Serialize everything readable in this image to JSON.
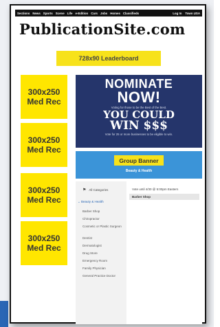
{
  "nav": {
    "links": [
      "Sections",
      "News",
      "Sports",
      "Scene",
      "Life",
      "e-Edition",
      "Cars",
      "Jobs",
      "Homes",
      "Classifieds"
    ],
    "right": [
      "Log In",
      "Town USA"
    ]
  },
  "site_title": "PublicationSite.com",
  "leaderboard_label": "728x90 Leaderboard",
  "med_recs": [
    {
      "line1": "300x250",
      "line2": "Med Rec"
    },
    {
      "line1": "300x250",
      "line2": "Med Rec"
    },
    {
      "line1": "300x250",
      "line2": "Med Rec"
    },
    {
      "line1": "300x250",
      "line2": "Med Rec"
    }
  ],
  "nominate_ad": {
    "line1": "NOMINATE",
    "line2": "NOW!",
    "subtext": "Voting for those to be the Best of the Best.",
    "line3": "YOU COULD",
    "line4": "WIN $$$",
    "footer": "Vote for 25 or more businesses to be eligible to win."
  },
  "group_banner": {
    "label": "Group Banner",
    "category": "Beauty & Health"
  },
  "directory": {
    "all_categories": "All Categories",
    "vote_until": "Vote until 4/30 @ 5:00pm Eastern",
    "selected_header": "Barber Shop",
    "active_category": "Beauty & Health",
    "items": [
      "Barber Shop",
      "Chiropractor",
      "Cosmetic or Plastic Surgeon",
      "Dentist",
      "Dermatologist",
      "Drug Store",
      "Emergency Room",
      "Family Physician",
      "General Practice Doctor"
    ]
  },
  "colors": {
    "accent_yellow": "#ffe600",
    "banner_blue": "#3b94d8",
    "ad_navy": "#25356b"
  }
}
